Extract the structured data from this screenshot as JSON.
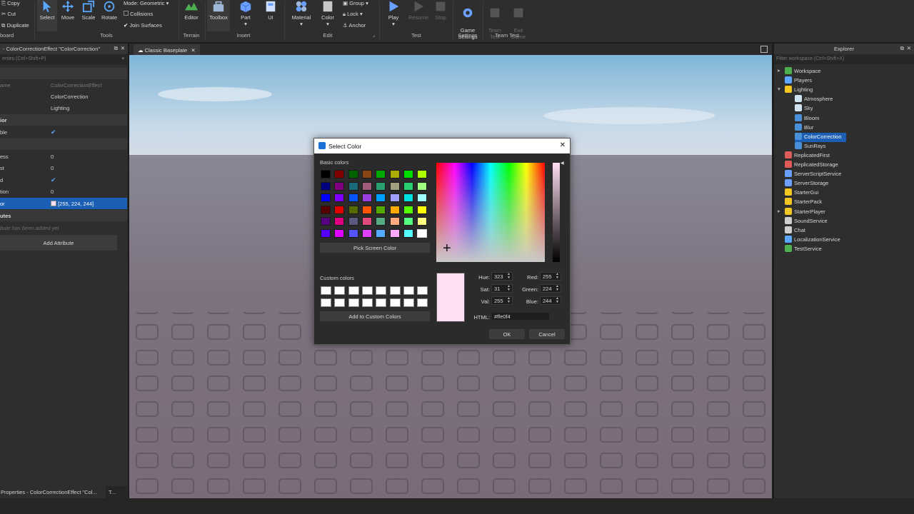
{
  "ribbon": {
    "clipboard": {
      "copy": "Copy",
      "cut": "Cut",
      "duplicate": "Duplicate",
      "label": "board"
    },
    "tools": {
      "select": "Select",
      "move": "Move",
      "scale": "Scale",
      "rotate": "Rotate",
      "label": "Tools",
      "mode_label": "Mode:",
      "mode_value": "Geometric",
      "collisions": "Collisions",
      "join_surfaces": "Join Surfaces"
    },
    "terrain": {
      "editor": "Editor",
      "label": "Terrain"
    },
    "toolbox": "Toolbox",
    "insert": {
      "part": "Part",
      "ui": "UI",
      "label": "Insert"
    },
    "edit": {
      "material": "Material",
      "color": "Color",
      "group": "Group",
      "lock": "Lock",
      "anchor": "Anchor",
      "label": "Edit"
    },
    "test": {
      "play": "Play",
      "resume": "Resume",
      "stop": "Stop",
      "label": "Test"
    },
    "settings": {
      "game_settings": "Game\nSettings",
      "label": "Settings"
    },
    "team_test": {
      "team_test": "Team\nTest",
      "exit_game": "Exit\nGame",
      "label": "Team Test"
    }
  },
  "properties": {
    "header": "- ColorCorrectionEffect \"ColorCorrection\"",
    "filter_placeholder": "erties (Ctrl+Shift+P)",
    "rows": {
      "classname_k": "ame",
      "classname_v": "ColorCorrectionEffect",
      "name_v": "ColorCorrection",
      "parent_v": "Lighting",
      "section_behavior": "ior",
      "enabled_k": "ble",
      "brightness_k": "ess",
      "brightness_v": "0",
      "contrast_k": "st",
      "contrast_v": "0",
      "enabled2_k": "d",
      "saturation_k": "tion",
      "saturation_v": "0",
      "tint_k": "or",
      "tint_v": "[255, 224, 244]",
      "section_attributes": "utes",
      "no_attrs": "bute has been added yet",
      "add_attribute": "Add Attribute"
    },
    "bottom_tab": "Properties - ColorCorrectionEffect \"Col...",
    "bottom_tab2": "T..."
  },
  "viewport": {
    "tab": "Classic Baseplate"
  },
  "explorer": {
    "title": "Explorer",
    "filter_placeholder": "Filter workspace (Ctrl+Shift+X)",
    "items": [
      {
        "label": "Workspace",
        "icon": "workspace-icon",
        "color": "#4caf50"
      },
      {
        "label": "Players",
        "icon": "players-icon",
        "color": "#5aa9ff"
      },
      {
        "label": "Lighting",
        "icon": "lighting-icon",
        "color": "#f3c623"
      },
      {
        "label": "Atmosphere",
        "icon": "atmosphere-icon",
        "color": "#cfe3f0"
      },
      {
        "label": "Sky",
        "icon": "sky-icon",
        "color": "#cfe3f0"
      },
      {
        "label": "Bloom",
        "icon": "bloom-icon",
        "color": "#4a90d9"
      },
      {
        "label": "Blur",
        "icon": "blur-icon",
        "color": "#4a90d9"
      },
      {
        "label": "ColorCorrection",
        "icon": "colorcorrection-icon",
        "color": "#4a90d9"
      },
      {
        "label": "SunRays",
        "icon": "sunrays-icon",
        "color": "#4a90d9"
      },
      {
        "label": "ReplicatedFirst",
        "icon": "replicatedfirst-icon",
        "color": "#e05a5a"
      },
      {
        "label": "ReplicatedStorage",
        "icon": "replicatedstorage-icon",
        "color": "#e05a5a"
      },
      {
        "label": "ServerScriptService",
        "icon": "serverscriptservice-icon",
        "color": "#6aa0ff"
      },
      {
        "label": "ServerStorage",
        "icon": "serverstorage-icon",
        "color": "#6aa0ff"
      },
      {
        "label": "StarterGui",
        "icon": "startergui-icon",
        "color": "#f3c623"
      },
      {
        "label": "StarterPack",
        "icon": "starterpack-icon",
        "color": "#f3c623"
      },
      {
        "label": "StarterPlayer",
        "icon": "starterplayer-icon",
        "color": "#f3c623"
      },
      {
        "label": "SoundService",
        "icon": "soundservice-icon",
        "color": "#cfcfcf"
      },
      {
        "label": "Chat",
        "icon": "chat-icon",
        "color": "#cfcfcf"
      },
      {
        "label": "LocalizationService",
        "icon": "localizationservice-icon",
        "color": "#5aa9ff"
      },
      {
        "label": "TestService",
        "icon": "testservice-icon",
        "color": "#4caf50"
      }
    ]
  },
  "dialog": {
    "title": "Select Color",
    "basic_colors_label": "Basic colors",
    "basic_colors": [
      "#000000",
      "#800000",
      "#006400",
      "#8b4513",
      "#00aa00",
      "#aaaa00",
      "#00dd00",
      "#aaff00",
      "#00007f",
      "#800080",
      "#1a6a7a",
      "#a05c7c",
      "#2aa070",
      "#a0a080",
      "#2acc70",
      "#a0ff80",
      "#0000ff",
      "#8000ff",
      "#0055ff",
      "#9a40e0",
      "#00a0ff",
      "#a0a0ff",
      "#00e0e0",
      "#a0ffff",
      "#550000",
      "#e00000",
      "#556b00",
      "#ff5500",
      "#55aa00",
      "#ffaa00",
      "#55ff00",
      "#ffff00",
      "#55007f",
      "#e0007f",
      "#5a5a80",
      "#e04a7f",
      "#55aa7f",
      "#ffaa7f",
      "#55ff7f",
      "#ffff7f",
      "#5500ff",
      "#e000ff",
      "#5555ff",
      "#e040ff",
      "#55aaff",
      "#ffaaff",
      "#55ffff",
      "#ffffff"
    ],
    "pick_screen": "Pick Screen Color",
    "custom_colors_label": "Custom colors",
    "add_custom": "Add to Custom Colors",
    "hue_label": "Hue:",
    "hue": "323",
    "sat_label": "Sat:",
    "sat": "31",
    "val_label": "Val:",
    "val": "255",
    "red_label": "Red:",
    "red": "255",
    "green_label": "Green:",
    "green": "224",
    "blue_label": "Blue:",
    "blue": "244",
    "html_label": "HTML:",
    "html": "#ffe0f4",
    "ok": "OK",
    "cancel": "Cancel",
    "current_color": "#ffe0f4"
  }
}
